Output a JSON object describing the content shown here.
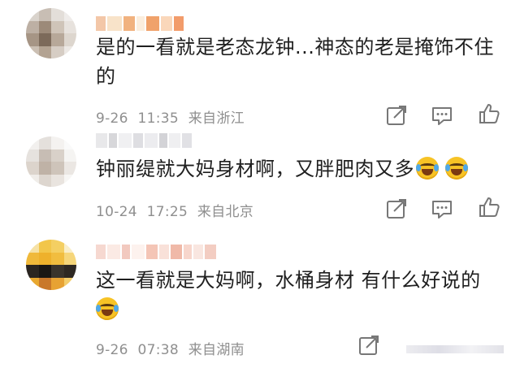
{
  "comments": [
    {
      "text_line1": "是的一看就是老态龙钟...神态的老是掩饰不住",
      "text_line2": "的",
      "date": "9-26",
      "time": "11:35",
      "location": "来自浙江"
    },
    {
      "text_line1": "钟丽缇就大妈身材啊，又胖肥肉又多",
      "date": "10-24",
      "time": "17:25",
      "location": "来自北京"
    },
    {
      "text_line1": "这一看就是大妈啊，水桶身材 有什么好说的",
      "date": "9-26",
      "time": "07:38",
      "location": "来自湖南"
    }
  ],
  "icons": {
    "share": "share-icon",
    "comment": "comment-icon",
    "like": "like-icon",
    "emoji": "laugh-cry-emoji"
  },
  "colors": {
    "text": "#1f1f1f",
    "meta": "#8f8f8f",
    "icon": "#777777",
    "emoji": "#f7c325"
  }
}
